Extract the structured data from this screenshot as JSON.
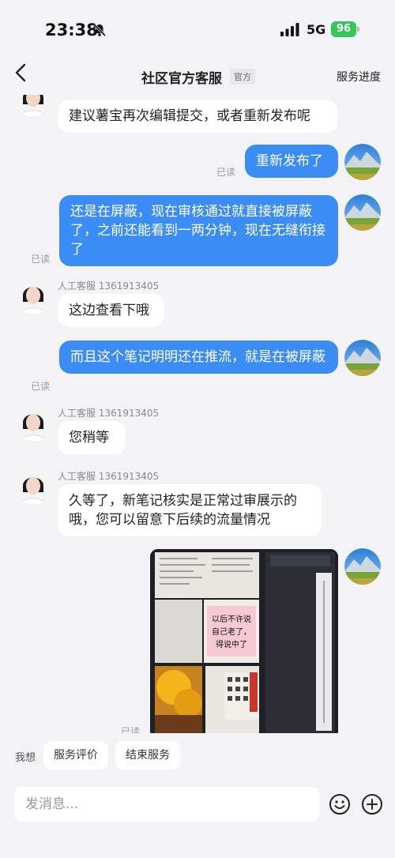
{
  "status": {
    "time": "23:38",
    "network": "5G",
    "battery": "96"
  },
  "nav": {
    "title": "社区官方客服",
    "badge": "官方",
    "right": "服务进度"
  },
  "messages": {
    "m1": "建议薯宝再次编辑提交，或者重新发布呢",
    "m2": "重新发布了",
    "m2_read": "已读",
    "m3": "还是在屏蔽，现在审核通过就直接被屏蔽了，之前还能看到一两分钟，现在无缝衔接了",
    "m3_read": "已读",
    "m4_sender": "人工客服 1361913405",
    "m4": "这边查看下哦",
    "m5": "而且这个笔记明明还在推流，就是在被屏蔽",
    "m5_read": "已读",
    "m6_sender": "人工客服 1361913405",
    "m6": "您稍等",
    "m7_sender": "人工客服 1361913405",
    "m7": "久等了，新笔记核实是正常过审展示的哦，您可以留意下后续的流量情况",
    "m8_read": "已读"
  },
  "photo_text": {
    "sticky_note": "以后不许说\n自己老了，\n得说中了"
  },
  "quick": {
    "label": "我想",
    "rate": "服务评价",
    "end": "结束服务"
  },
  "input": {
    "placeholder": "发消息..."
  },
  "icons": [
    "bell-slash-icon",
    "signal-icon",
    "back-chevron-icon",
    "emoji-icon",
    "plus-icon"
  ],
  "colors": {
    "bubble_out": "#3b8cf5",
    "bubble_in": "#ffffff",
    "battery": "#34c759"
  }
}
